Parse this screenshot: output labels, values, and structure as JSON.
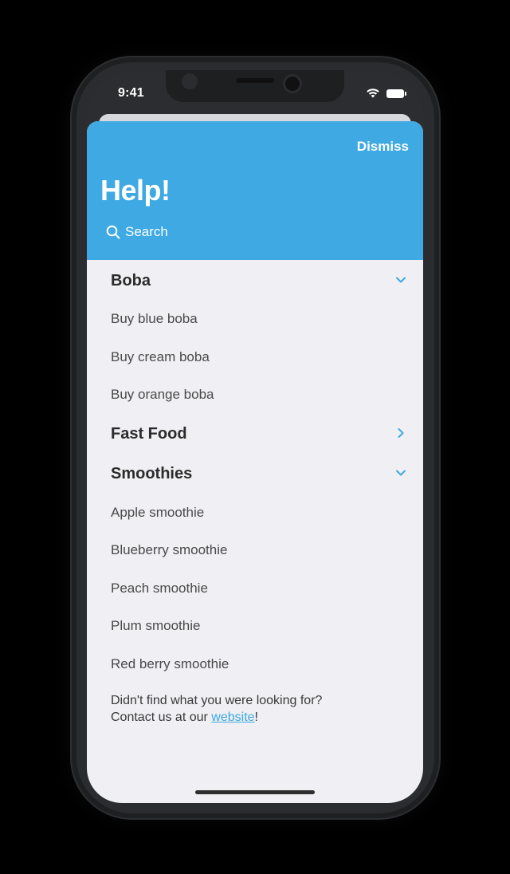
{
  "status_bar": {
    "time": "9:41"
  },
  "header": {
    "dismiss_label": "Dismiss",
    "title": "Help!",
    "search_placeholder": "Search"
  },
  "colors": {
    "accent": "#3ea9e2",
    "background": "#efeff4"
  },
  "sections": [
    {
      "label": "Boba",
      "state": "expanded",
      "items": [
        "Buy blue boba",
        "Buy cream boba",
        "Buy orange boba"
      ]
    },
    {
      "label": "Fast Food",
      "state": "collapsed",
      "items": []
    },
    {
      "label": "Smoothies",
      "state": "expanded",
      "items": [
        "Apple smoothie",
        "Blueberry smoothie",
        "Peach smoothie",
        "Plum smoothie",
        "Red berry smoothie"
      ]
    }
  ],
  "footer": {
    "line1": "Didn't find what you were looking for?",
    "line2_prefix": "Contact us at our ",
    "link": "website",
    "line2_suffix": "!"
  }
}
